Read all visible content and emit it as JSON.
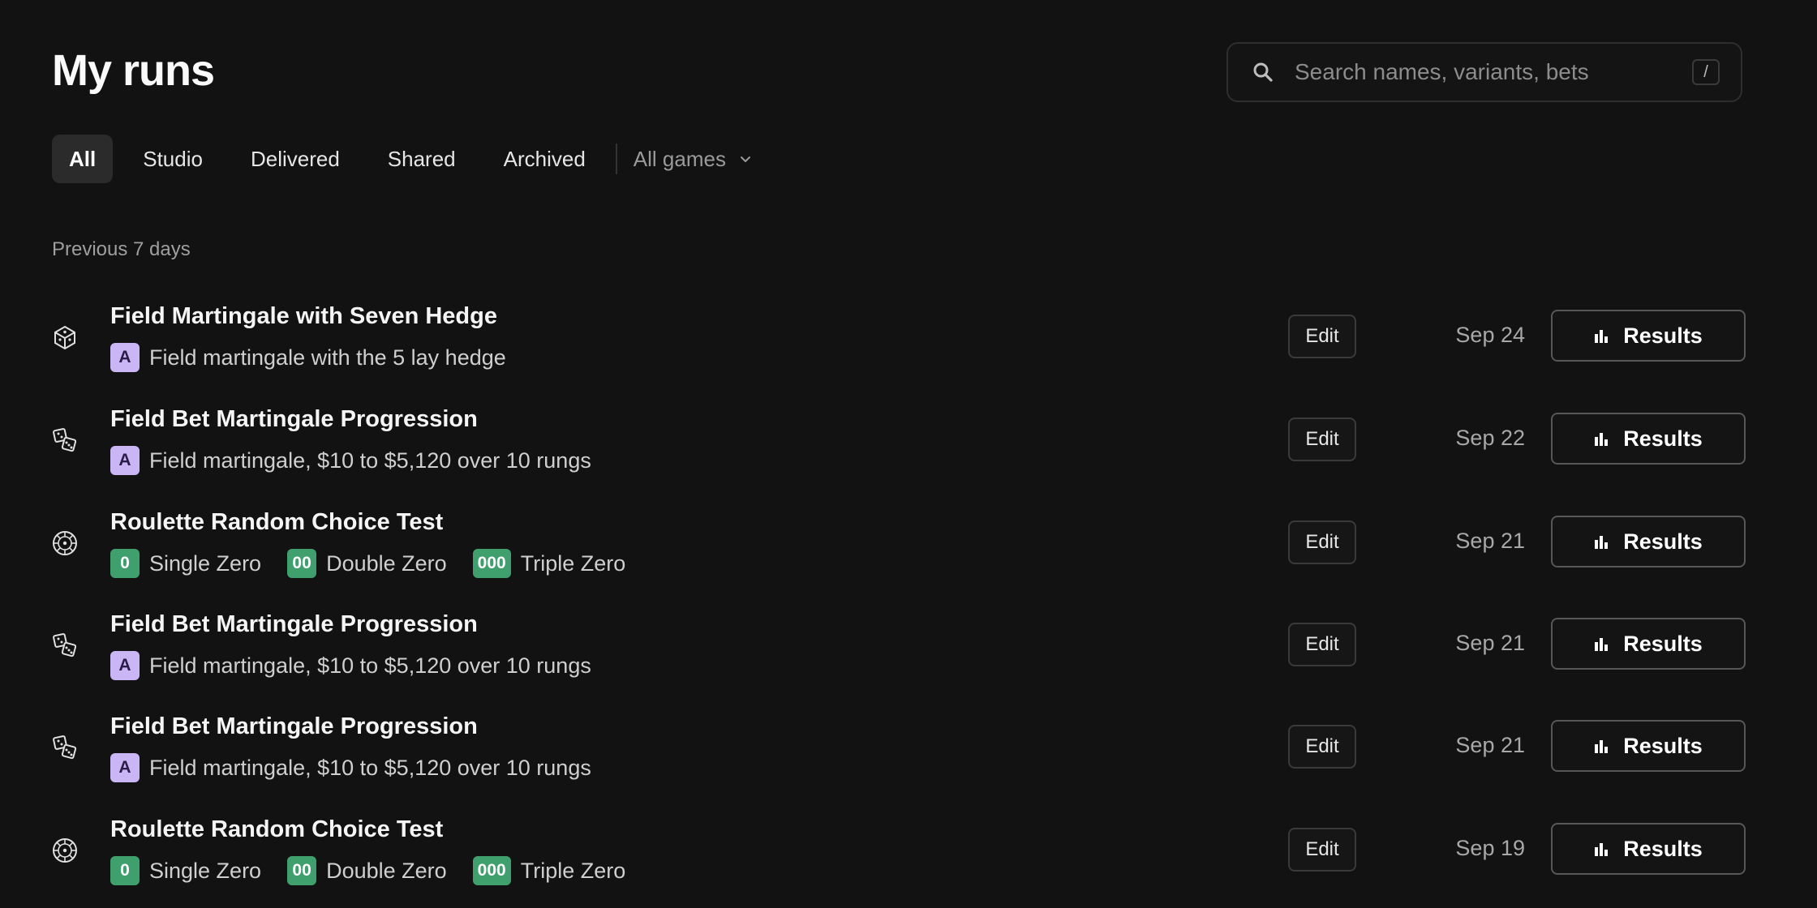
{
  "header": {
    "title": "My runs"
  },
  "search": {
    "placeholder": "Search names, variants, bets",
    "shortcut": "/"
  },
  "tabs": [
    {
      "label": "All",
      "active": true
    },
    {
      "label": "Studio",
      "active": false
    },
    {
      "label": "Delivered",
      "active": false
    },
    {
      "label": "Shared",
      "active": false
    },
    {
      "label": "Archived",
      "active": false
    }
  ],
  "games_filter": {
    "label": "All games",
    "icon": "chevron-down-icon"
  },
  "section": {
    "label": "Previous 7 days"
  },
  "colors": {
    "background": "#121212",
    "badge_purple": "#cbb6f5",
    "badge_green": "#3fa06e"
  },
  "runs": [
    {
      "title": "Field Martingale with Seven Hedge",
      "game_icon": "die-icon",
      "variants": [
        {
          "badge": "A",
          "badge_color": "purple",
          "label": "Field martingale with the 5 lay hedge"
        }
      ],
      "edit_label": "Edit",
      "date": "Sep 24",
      "results_label": "Results"
    },
    {
      "title": "Field Bet Martingale Progression",
      "game_icon": "dice-pair-icon",
      "variants": [
        {
          "badge": "A",
          "badge_color": "purple",
          "label": "Field martingale, $10 to $5,120 over 10 rungs"
        }
      ],
      "edit_label": "Edit",
      "date": "Sep 22",
      "results_label": "Results"
    },
    {
      "title": "Roulette Random Choice Test",
      "game_icon": "roulette-wheel-icon",
      "variants": [
        {
          "badge": "0",
          "badge_color": "green",
          "label": "Single Zero"
        },
        {
          "badge": "00",
          "badge_color": "green",
          "label": "Double Zero"
        },
        {
          "badge": "000",
          "badge_color": "green",
          "label": "Triple Zero"
        }
      ],
      "edit_label": "Edit",
      "date": "Sep 21",
      "results_label": "Results"
    },
    {
      "title": "Field Bet Martingale Progression",
      "game_icon": "dice-pair-icon",
      "variants": [
        {
          "badge": "A",
          "badge_color": "purple",
          "label": "Field martingale, $10 to $5,120 over 10 rungs"
        }
      ],
      "edit_label": "Edit",
      "date": "Sep 21",
      "results_label": "Results"
    },
    {
      "title": "Field Bet Martingale Progression",
      "game_icon": "dice-pair-icon",
      "variants": [
        {
          "badge": "A",
          "badge_color": "purple",
          "label": "Field martingale, $10 to $5,120 over 10 rungs"
        }
      ],
      "edit_label": "Edit",
      "date": "Sep 21",
      "results_label": "Results"
    },
    {
      "title": "Roulette Random Choice Test",
      "game_icon": "roulette-wheel-icon",
      "variants": [
        {
          "badge": "0",
          "badge_color": "green",
          "label": "Single Zero"
        },
        {
          "badge": "00",
          "badge_color": "green",
          "label": "Double Zero"
        },
        {
          "badge": "000",
          "badge_color": "green",
          "label": "Triple Zero"
        }
      ],
      "edit_label": "Edit",
      "date": "Sep 19",
      "results_label": "Results"
    }
  ]
}
